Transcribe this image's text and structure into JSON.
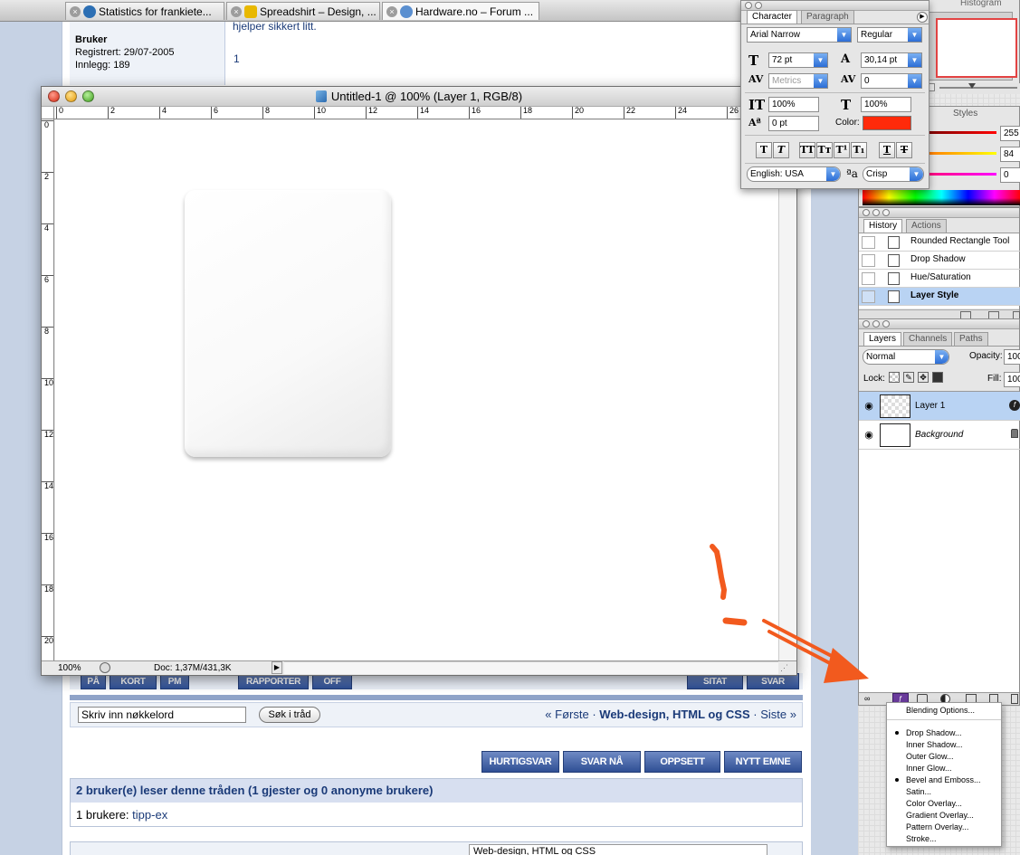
{
  "browser": {
    "tabs": [
      {
        "label": "Statistics for frankiete...",
        "icon": "stats-favicon"
      },
      {
        "label": "Spreadshirt – Design, ...",
        "icon": "spreadshirt-favicon"
      },
      {
        "label": "Hardware.no – Forum ...",
        "icon": "globe-favicon"
      }
    ]
  },
  "forum": {
    "post": {
      "author": "Bruker",
      "registered": "Registrert: 29/07-2005",
      "posts": "Innlegg: 189",
      "snippet": "hjelper sikkert litt.",
      "post_number": "1"
    },
    "post_buttons_left": [
      "PÅ",
      "KORT",
      "PM"
    ],
    "post_buttons_mid": [
      "RAPPORTER",
      "OFF"
    ],
    "post_buttons_right": [
      "SITAT",
      "SVAR"
    ],
    "search": {
      "placeholder": "Skriv inn nøkkelord",
      "button": "Søk i tråd"
    },
    "nav": {
      "first": "« Første",
      "sep1": "·",
      "current": "Web-design, HTML og CSS",
      "sep2": "·",
      "last": "Siste »"
    },
    "action_buttons": [
      "HURTIGSVAR",
      "SVAR NÅ",
      "OPPSETT",
      "NYTT EMNE"
    ],
    "readers_title": "2 bruker(e) leser denne tråden (1 gjester og 0 anonyme brukere)",
    "readers_label": "1 brukere:",
    "readers_user": "tipp-ex",
    "bottom_select": "Web-design, HTML og CSS"
  },
  "document": {
    "title": "Untitled-1 @ 100% (Layer 1, RGB/8)",
    "ruler_h": [
      "0",
      "2",
      "4",
      "6",
      "8",
      "10",
      "12",
      "14",
      "16",
      "18",
      "20",
      "22",
      "24",
      "26"
    ],
    "ruler_v": [
      "0",
      "2",
      "4",
      "6",
      "8",
      "10",
      "12",
      "14",
      "16",
      "18",
      "20"
    ],
    "zoom": "100%",
    "doc_size": "Doc: 1,37M/431,3K"
  },
  "character_panel": {
    "tabs": [
      "Character",
      "Paragraph"
    ],
    "font_family": "Arial Narrow",
    "font_style": "Regular",
    "size": "72 pt",
    "leading": "30,14 pt",
    "kerning": "Metrics",
    "tracking": "0",
    "vertical_scale": "100%",
    "horizontal_scale": "100%",
    "baseline_shift": "0 pt",
    "color_label": "Color:",
    "color": "#ff2a0a",
    "style_buttons": [
      "T",
      "T",
      "TT",
      "Tт",
      "T¹",
      "T₁",
      "T",
      "T"
    ],
    "language": "English: USA",
    "aa_label": "ªa",
    "antialias": "Crisp"
  },
  "navigator_panel": {
    "tabs_visible": [
      "Histogram"
    ]
  },
  "color_panel": {
    "tabs_visible": [
      "Styles"
    ],
    "values": [
      "255",
      "84",
      "0"
    ]
  },
  "history_panel": {
    "tabs": [
      "History",
      "Actions"
    ],
    "items": [
      "Rounded Rectangle Tool",
      "Drop Shadow",
      "Hue/Saturation",
      "Layer Style"
    ]
  },
  "layers_panel": {
    "tabs": [
      "Layers",
      "Channels",
      "Paths"
    ],
    "blend_mode": "Normal",
    "opacity_label": "Opacity:",
    "opacity": "100",
    "lock_label": "Lock:",
    "fill_label": "Fill:",
    "fill": "100",
    "layers": [
      {
        "name": "Layer 1",
        "selected": true
      },
      {
        "name": "Background",
        "selected": false
      }
    ]
  },
  "layer_style_menu": {
    "items": [
      "Blending Options...",
      "Drop Shadow...",
      "Inner Shadow...",
      "Outer Glow...",
      "Inner Glow...",
      "Bevel and Emboss...",
      "Satin...",
      "Color Overlay...",
      "Gradient Overlay...",
      "Pattern Overlay...",
      "Stroke..."
    ],
    "checked": [
      "Drop Shadow...",
      "Bevel and Emboss..."
    ]
  },
  "annotation": {
    "color": "#f25a1e"
  }
}
